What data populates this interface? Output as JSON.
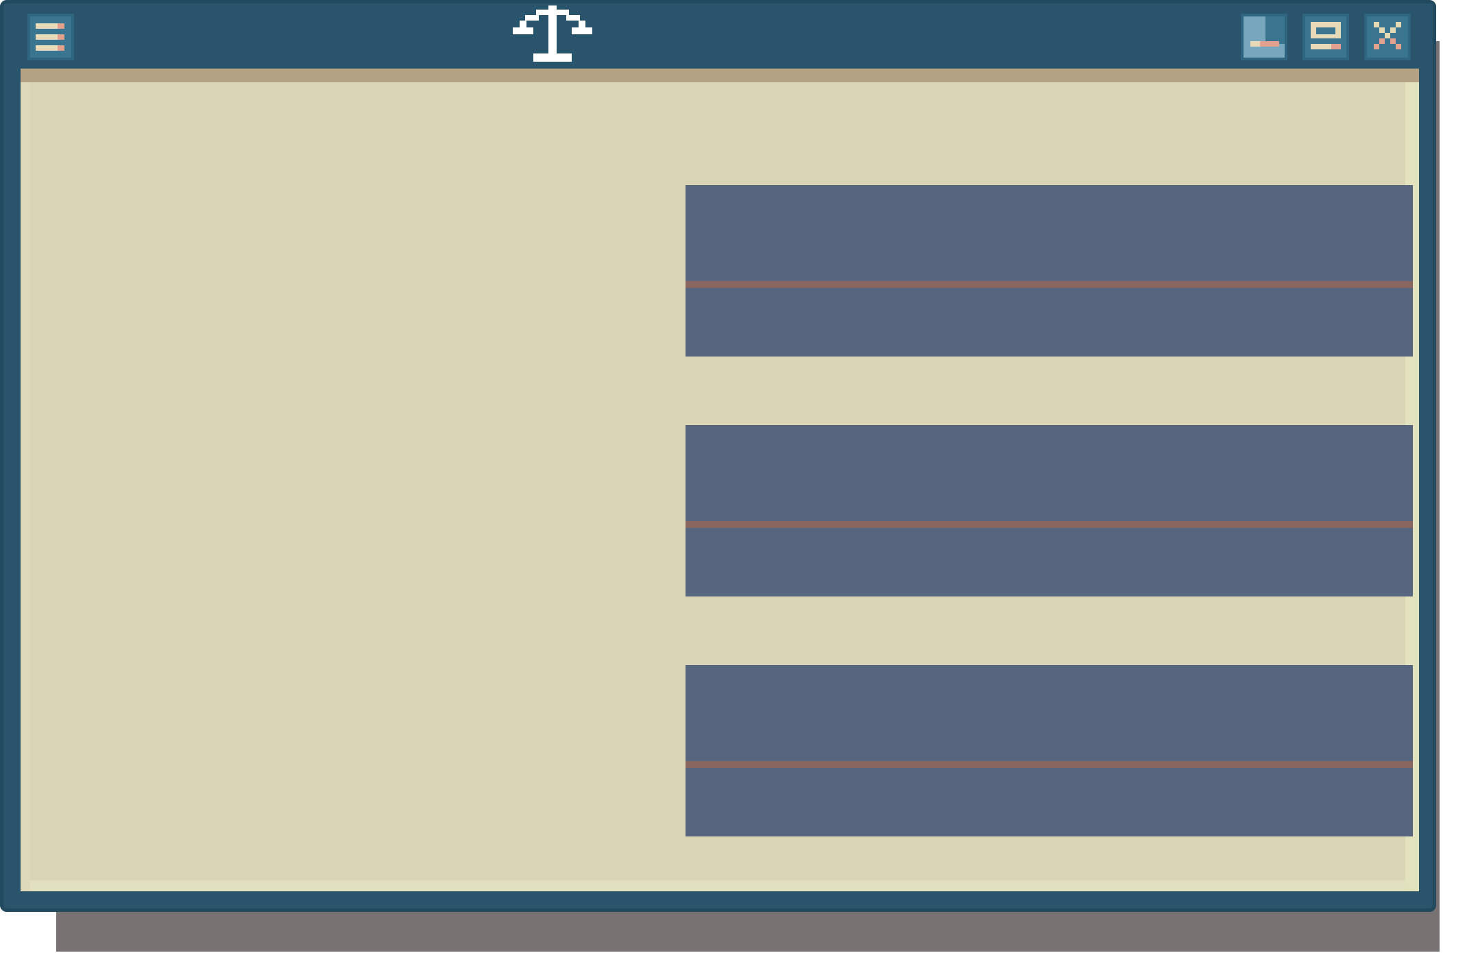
{
  "window": {
    "title_icon": "scales-icon",
    "controls": [
      "menu-icon",
      "minimize-icon",
      "maximize-icon",
      "close-icon"
    ]
  },
  "panels": [
    {
      "id": 1
    },
    {
      "id": 2
    },
    {
      "id": 3
    }
  ],
  "colors": {
    "frame": "#2a536c",
    "content": "#d9d4b3",
    "panel": "#58657e",
    "divider": "#8a6661",
    "shadow": "#787272",
    "button": "#3a7590"
  }
}
